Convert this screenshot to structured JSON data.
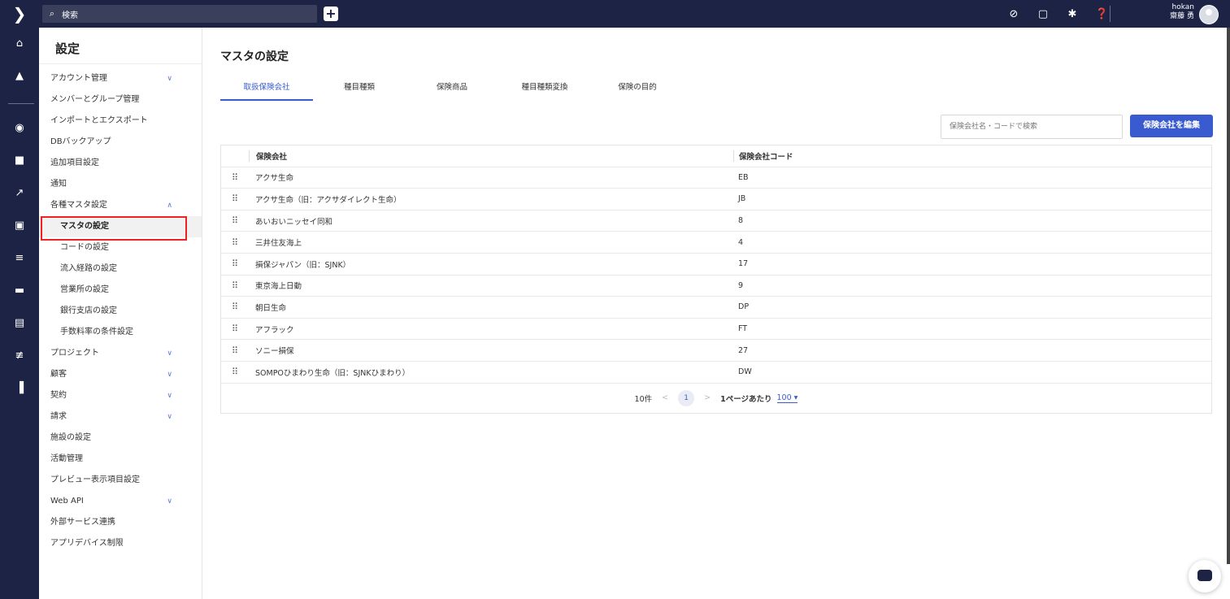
{
  "topbar": {
    "search_label": "検索",
    "add_label": "+",
    "user_line1": "hokan",
    "user_line2": "齋藤 勇"
  },
  "icons": {
    "top": [
      "check-circle-icon",
      "calendar-icon",
      "gear-icon",
      "help-icon"
    ],
    "rail": [
      "home-icon",
      "bell-icon",
      "person-icon",
      "document-icon",
      "trend-icon",
      "badge-icon",
      "checklist-icon",
      "folder-icon",
      "book-icon",
      "list-x-icon",
      "bar-chart-icon"
    ]
  },
  "sidebar": {
    "title": "設定",
    "items": [
      {
        "label": "アカウント管理",
        "chev": "∨"
      },
      {
        "label": "メンバーとグループ管理"
      },
      {
        "label": "インポートとエクスポート"
      },
      {
        "label": "DBバックアップ"
      },
      {
        "label": "追加項目設定"
      },
      {
        "label": "通知"
      },
      {
        "label": "各種マスタ設定",
        "chev": "∧"
      },
      {
        "label": "マスタの設定"
      },
      {
        "label": "コードの設定"
      },
      {
        "label": "流入経路の設定"
      },
      {
        "label": "営業所の設定"
      },
      {
        "label": "銀行支店の設定"
      },
      {
        "label": "手数料率の条件設定"
      },
      {
        "label": "プロジェクト",
        "chev": "∨"
      },
      {
        "label": "顧客",
        "chev": "∨"
      },
      {
        "label": "契約",
        "chev": "∨"
      },
      {
        "label": "請求",
        "chev": "∨"
      },
      {
        "label": "施設の設定"
      },
      {
        "label": "活動管理"
      },
      {
        "label": "プレビュー表示項目設定"
      },
      {
        "label": "Web API",
        "chev": "∨"
      },
      {
        "label": "外部サービス連携"
      },
      {
        "label": "アプリデバイス制限"
      }
    ]
  },
  "main": {
    "title": "マスタの設定",
    "tabs": [
      "取扱保険会社",
      "種目種類",
      "保険商品",
      "種目種類変換",
      "保険の目的"
    ],
    "search_placeholder": "保険会社名・コードで検索",
    "edit_button": "保険会社を編集",
    "table": {
      "headers": [
        "保険会社",
        "保険会社コード"
      ],
      "rows": [
        [
          "アクサ生命",
          "EB"
        ],
        [
          "アクサ生命（旧：アクサダイレクト生命）",
          "JB"
        ],
        [
          "あいおいニッセイ同和",
          "8"
        ],
        [
          "三井住友海上",
          "4"
        ],
        [
          "損保ジャパン（旧：SJNK）",
          "17"
        ],
        [
          "東京海上日動",
          "9"
        ],
        [
          "朝日生命",
          "DP"
        ],
        [
          "アフラック",
          "FT"
        ],
        [
          "ソニー損保",
          "27"
        ],
        [
          "SOMPOひまわり生命（旧：SJNKひまわり）",
          "DW"
        ]
      ]
    },
    "pager": {
      "count": "10件",
      "prev": "<",
      "page": "1",
      "next": ">",
      "per_page_label": "1ページあたり",
      "per_page_value": "100"
    }
  }
}
